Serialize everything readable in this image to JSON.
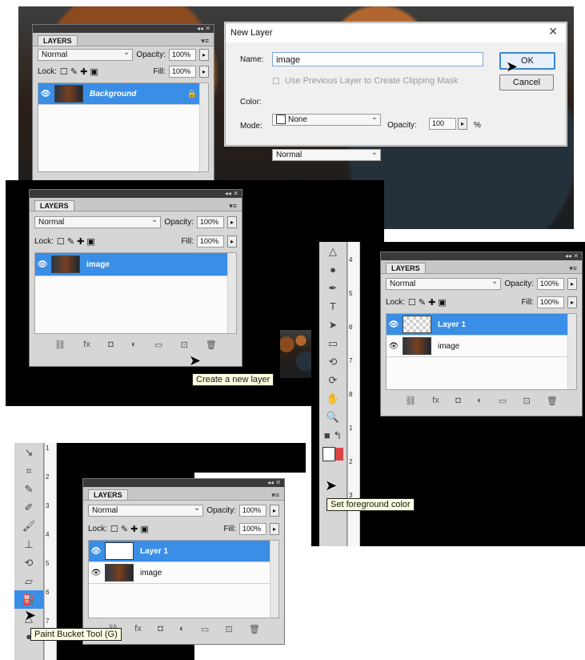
{
  "layers_panel_title": "LAYERS",
  "blend_mode": "Normal",
  "opacity_label": "Opacity:",
  "opacity_value": "100%",
  "lock_label": "Lock:",
  "fill_label": "Fill:",
  "fill_value": "100%",
  "panel1": {
    "layers": [
      "Background"
    ]
  },
  "panel2": {
    "layers": [
      "image"
    ],
    "tooltip": "Create a new layer"
  },
  "panel3": {
    "layers": [
      "Layer 1",
      "image"
    ],
    "tooltip": "Set foreground color"
  },
  "panel4": {
    "layers": [
      "Layer 1",
      "image"
    ],
    "tooltip": "Paint Bucket Tool (G)"
  },
  "dialog": {
    "title": "New Layer",
    "name_label": "Name:",
    "name_value": "image",
    "clip_label": "Use Previous Layer to Create Clipping Mask",
    "color_label": "Color:",
    "color_value": "None",
    "mode_label": "Mode:",
    "mode_value": "Normal",
    "opacity_label": "Opacity:",
    "opacity_value": "100",
    "percent": "%",
    "ok": "OK",
    "cancel": "Cancel"
  },
  "ruler_numbers": [
    "1",
    "2",
    "3",
    "4",
    "5",
    "6",
    "7",
    "8"
  ],
  "colors": {
    "accent": "#3a8ee6",
    "panel": "#d6d6d6"
  }
}
